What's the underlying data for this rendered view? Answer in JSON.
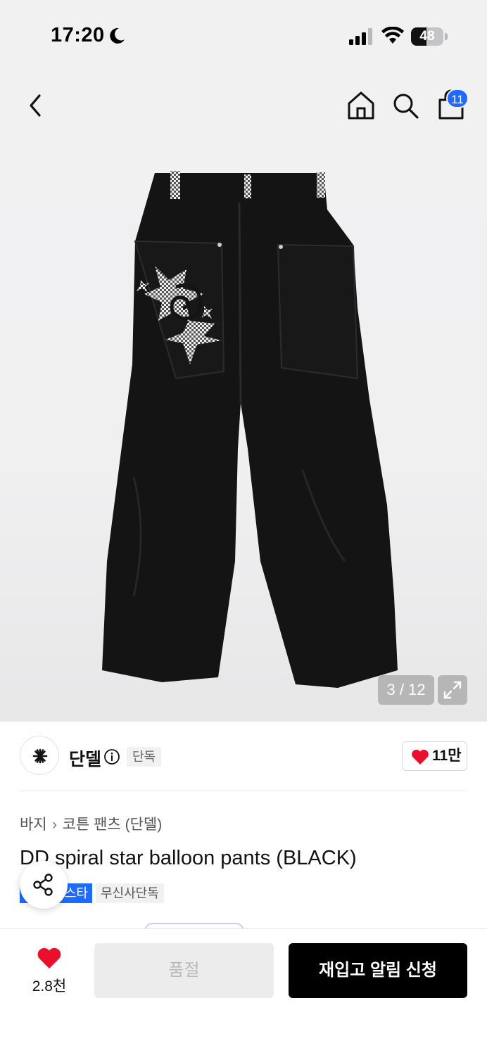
{
  "status_bar": {
    "time": "17:20",
    "battery": "48",
    "battery_fraction": 0.48
  },
  "nav": {
    "cart_count": "11"
  },
  "gallery": {
    "counter": "3 / 12"
  },
  "brand": {
    "name": "단델",
    "exclusive_badge": "단독",
    "like_count": "11만"
  },
  "product": {
    "breadcrumb": [
      "바지",
      "코튼 팬츠 (단델)"
    ],
    "title": "DD spiral star balloon pants (BLACK)",
    "tags": [
      "스타",
      "무신사단독"
    ]
  },
  "bottom_bar": {
    "wish_count": "2.8천",
    "soldout_label": "품절",
    "restock_label": "재입고 알림 신청"
  },
  "colors": {
    "accent_blue": "#1f6bff",
    "heart_red": "#e8102a",
    "primary_black": "#000000"
  }
}
